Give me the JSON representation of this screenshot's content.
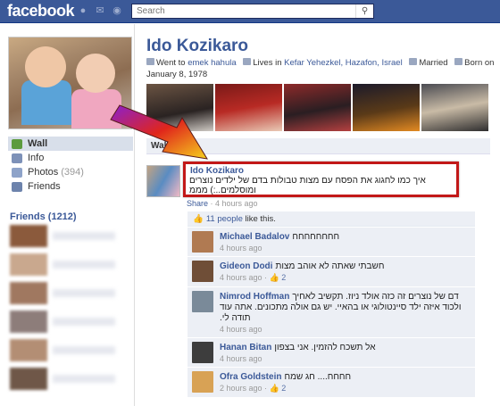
{
  "header": {
    "logo": "facebook",
    "search_placeholder": "Search",
    "search_icon": "magnifier-icon",
    "jewels": [
      "friend-requests-icon",
      "messages-icon",
      "notifications-icon"
    ]
  },
  "sidebar": {
    "nav": [
      {
        "label": "Wall",
        "count": "",
        "icon": "wall-icon",
        "active": true
      },
      {
        "label": "Info",
        "count": "",
        "icon": "info-icon"
      },
      {
        "label": "Photos",
        "count": "(394)",
        "icon": "photos-icon"
      },
      {
        "label": "Friends",
        "count": "",
        "icon": "friends-icon"
      }
    ],
    "friends_heading": "Friends (1212)"
  },
  "profile": {
    "name": "Ido Kozikaro",
    "went_to_prefix": "Went to",
    "school": "emek hahula",
    "lives_prefix": "Lives in",
    "location": "Kefar Yehezkel, Hazafon, Israel",
    "relationship": "Married",
    "born": "Born on January 8, 1978"
  },
  "tabs": {
    "wall": "Wall"
  },
  "post": {
    "author": "Ido Kozikaro",
    "text": "איך כמו לחגוג את הפסח עם מצות טבולות בדם של ילדים נוצרים ומוסלמים..:) מממ",
    "share": "Share",
    "time": "4 hours ago",
    "likes_count": "11 people",
    "likes_suffix": "like this."
  },
  "comments": [
    {
      "name": "Michael Badalov",
      "text": "חחחחחחחח",
      "time": "4 hours ago",
      "likes": "",
      "color": "#b07a52"
    },
    {
      "name": "Gideon Dodi",
      "text": "חשבתי שאתה לא אוהב מצות",
      "time": "4 hours ago",
      "likes": "2",
      "color": "#6f4e37"
    },
    {
      "name": "Nimrod Hoffman",
      "text": "דם של נוצרים זה כזה אולד ניוז. תקשיב לאחיך ולכוד איזה ילד סיינטולוגי או בהאיי. יש גם אולה מתכונים. אתה עוד תודה לי.",
      "time": "4 hours ago",
      "likes": "",
      "color": "#7a8a99"
    },
    {
      "name": "Hanan Bitan",
      "text": "אל תשכח להזמין. אני בצפון",
      "time": "4 hours ago",
      "likes": "",
      "color": "#3d3d3d"
    },
    {
      "name": "Ofra Goldstein",
      "text": "חחחח.... חג שמח",
      "time": "2 hours ago",
      "likes": "2",
      "color": "#d8a255"
    }
  ]
}
